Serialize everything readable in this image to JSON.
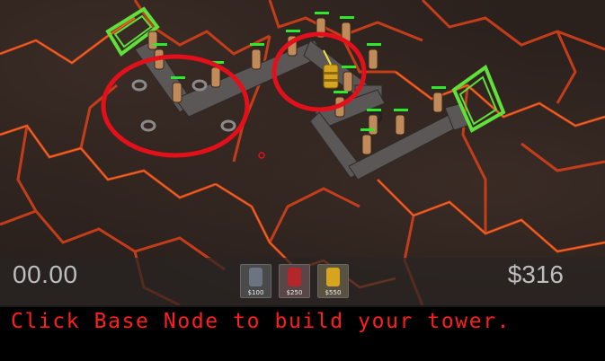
{
  "hud": {
    "timer": "00.00",
    "money": "$316"
  },
  "towers": [
    {
      "name": "gray-tower",
      "price": "$100",
      "color": "#6b7480"
    },
    {
      "name": "red-tower",
      "price": "$250",
      "color": "#b3262a"
    },
    {
      "name": "yellow-tower",
      "price": "$550",
      "color": "#d6a41e"
    }
  ],
  "message": {
    "text": "Click Base Node to build your tower."
  },
  "colors": {
    "lava": "#e0431a",
    "rock": "#2a201c",
    "path": "#5b5756",
    "highlight_ring": "#e3101b",
    "portal": "#5fe03a",
    "message_text": "#ff1e1e"
  }
}
